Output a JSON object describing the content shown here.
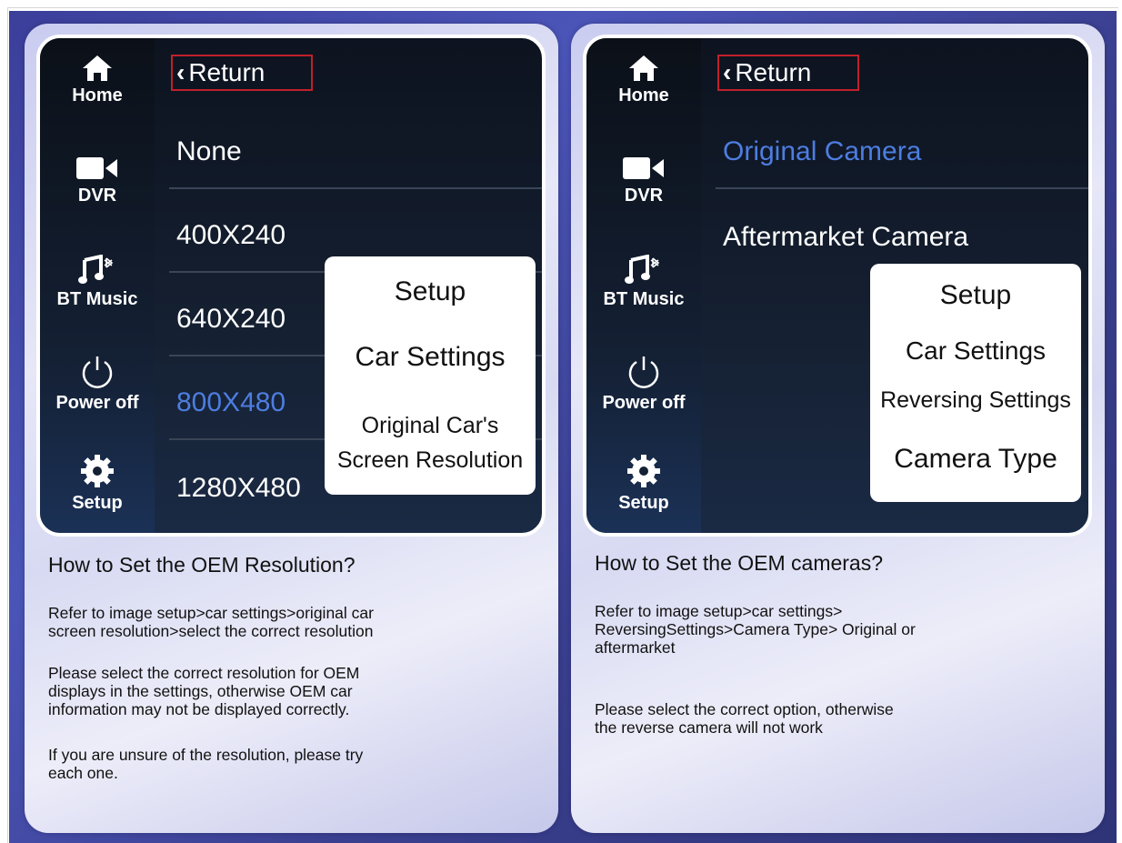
{
  "sidebar": {
    "items": [
      {
        "label": "Home",
        "icon": "home-icon"
      },
      {
        "label": "DVR",
        "icon": "video-camera-icon"
      },
      {
        "label": "BT Music",
        "icon": "bluetooth-music-icon"
      },
      {
        "label": "Power off",
        "icon": "power-icon"
      },
      {
        "label": "Setup",
        "icon": "gear-icon"
      }
    ]
  },
  "panels": [
    {
      "return_label": "Return",
      "options": [
        "None",
        "400X240",
        "640X240",
        "800X480",
        "1280X480"
      ],
      "selected_option": "800X480",
      "popup": [
        "Setup",
        "Car Settings",
        "Original Car's",
        "Screen Resolution"
      ],
      "heading": "How to Set the OEM Resolution?",
      "paragraphs": [
        [
          "Refer to image setup>car settings>original car",
          "screen resolution>select the correct resolution"
        ],
        [
          "Please select the correct resolution for OEM",
          "displays in the settings, otherwise OEM car",
          "information may not be displayed correctly."
        ],
        [
          "If you are unsure of the resolution, please try",
          "each one."
        ]
      ]
    },
    {
      "return_label": "Return",
      "options": [
        "Original Camera",
        "Aftermarket Camera"
      ],
      "selected_option": "Original Camera",
      "popup": [
        "Setup",
        "Car Settings",
        "Reversing Settings",
        "Camera Type"
      ],
      "heading": "How to Set the OEM cameras?",
      "paragraphs": [
        [
          "Refer to image setup>car settings>",
          "ReversingSettings>Camera Type> Original or",
          "aftermarket"
        ],
        [
          "Please select the correct option, otherwise",
          "the reverse camera will not work"
        ]
      ]
    }
  ],
  "colors": {
    "accent_blue": "#4d7de0",
    "return_border": "#c0202a",
    "backdrop": "#3b3f9a"
  }
}
